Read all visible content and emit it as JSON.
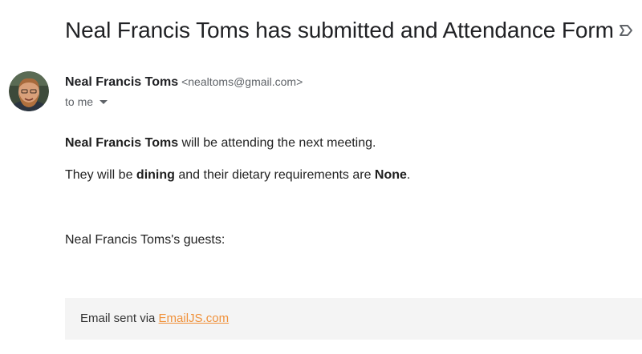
{
  "email": {
    "subject": "Neal Francis Toms has submitted and Attendance Form",
    "label_icon": "label-arrow-icon",
    "sender": {
      "name": "Neal Francis Toms",
      "email": "<nealtoms@gmail.com>",
      "avatar_icon": "avatar-photo"
    },
    "recipient_line": "to me",
    "body": {
      "p1_name": "Neal Francis Toms",
      "p1_rest": " will be attending the next meeting.",
      "p2_pre": "They will be ",
      "p2_dining": "dining",
      "p2_mid": " and their dietary requirements are ",
      "p2_req": "None",
      "p2_end": ".",
      "guests_heading": "Neal Francis Toms's guests:"
    },
    "footer": {
      "prefix": "Email sent via ",
      "link_text": "EmailJS.com"
    }
  },
  "colors": {
    "link": "#f0913a",
    "footer_bg": "#f4f4f4",
    "secondary_text": "#5f6368"
  }
}
